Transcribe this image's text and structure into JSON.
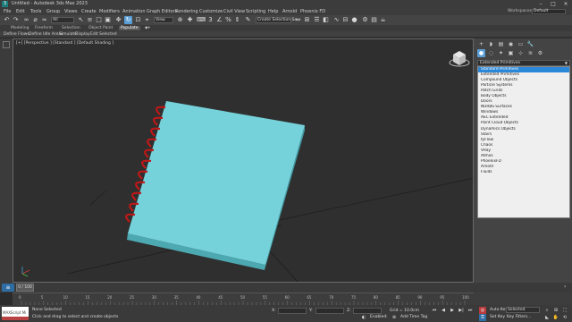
{
  "title": "Untitled - Autodesk 3ds Max 2023",
  "menu": [
    "File",
    "Edit",
    "Tools",
    "Group",
    "Views",
    "Create",
    "Modifiers",
    "Animation",
    "Graph Editors",
    "Rendering",
    "Customize",
    "Civil View",
    "Scripting",
    "Help",
    "Arnold",
    "Phoenix FD"
  ],
  "workspace": {
    "label": "Workspaces:",
    "value": "Default"
  },
  "toolbar": {
    "filter": "All",
    "ref_coord": "View",
    "selection_set": "Create Selection Se"
  },
  "ribbon_tabs": [
    "Modeling",
    "Freeform",
    "Selection",
    "Object Paint",
    "Populate"
  ],
  "ribbon_sub": [
    "Define Flows",
    "Define Idle Areas",
    "Simulate",
    "Display",
    "Edit Selected"
  ],
  "viewport_label": "[+] [Perspective ] [Standard ] [Default Shading ]",
  "command_panel": {
    "dropdown": "Extended Primitives",
    "list": [
      "Standard Primitives",
      "Extended Primitives",
      "Compound Objects",
      "Particle Systems",
      "Patch Grids",
      "Body Objects",
      "Doors",
      "NURBS Surfaces",
      "Windows",
      "AEC Extended",
      "Point Cloud Objects",
      "Dynamics Objects",
      "Stairs",
      "tyFlow",
      "Chaos",
      "VRay",
      "Atmos",
      "PhoenixFD",
      "Arnold",
      "Fluids"
    ],
    "selected_index": 0
  },
  "timeline": {
    "frame": "0 / 100",
    "ticks": [
      "0",
      "5",
      "10",
      "15",
      "20",
      "25",
      "30",
      "35",
      "40",
      "45",
      "50",
      "55",
      "60",
      "65",
      "70",
      "75",
      "80",
      "85",
      "90",
      "95",
      "100"
    ]
  },
  "status": {
    "maxscript": "MAXScript Mi",
    "selection": "None Selected",
    "prompt": "Click and drag to select and create objects",
    "x_label": "X:",
    "y_label": "Y:",
    "z_label": "Z:",
    "grid": "Grid = 10.0cm",
    "enabled": "Enabled:",
    "add_time_tag": "Add Time Tag",
    "auto_key": "Auto Key",
    "set_key": "Set Key",
    "key_mode": "Selected",
    "key_filters": "Key Filters..."
  }
}
